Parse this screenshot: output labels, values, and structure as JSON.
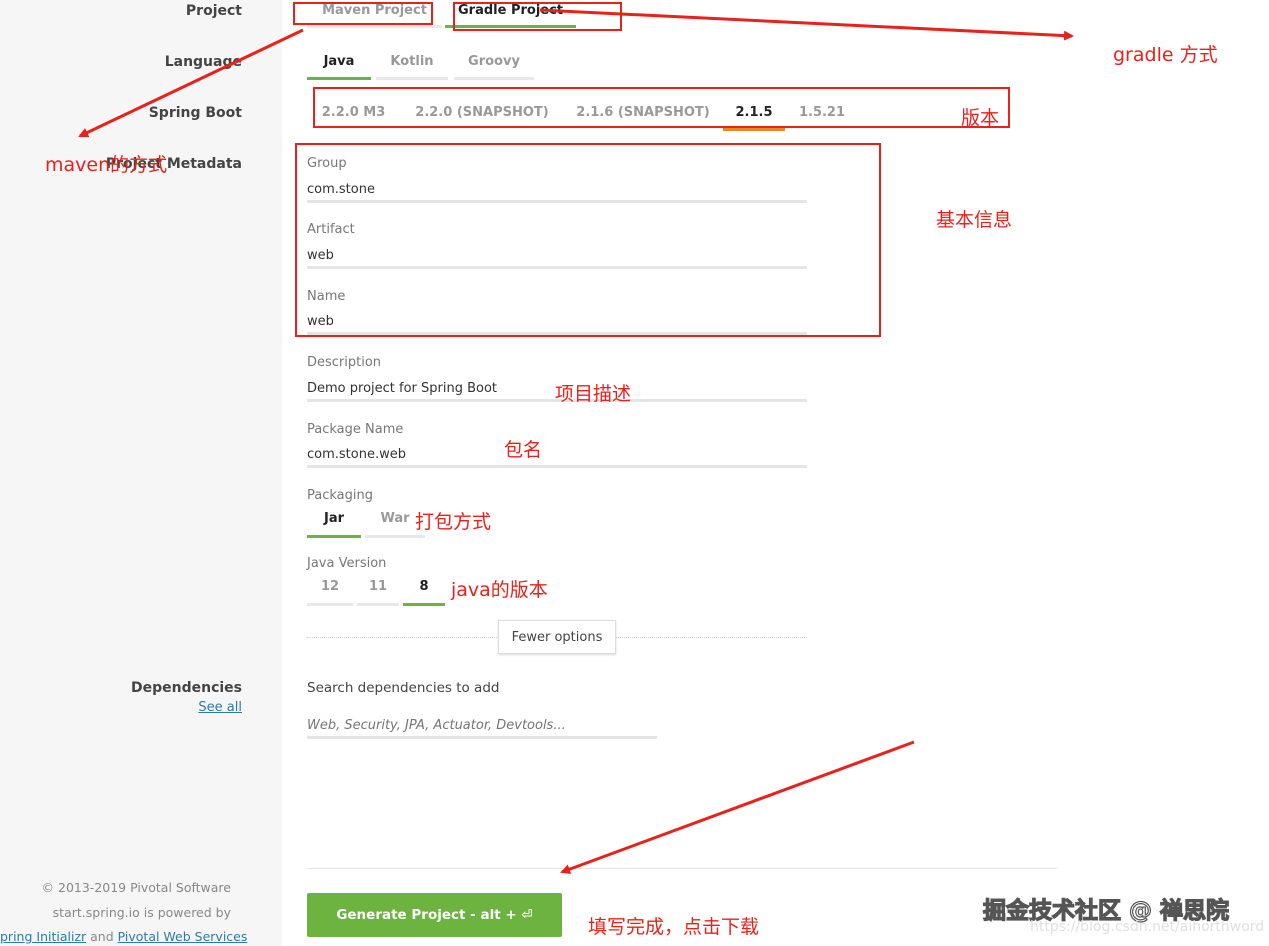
{
  "labels": {
    "project": "Project",
    "language": "Language",
    "spring_boot": "Spring Boot",
    "project_metadata": "Project Metadata",
    "dependencies": "Dependencies",
    "see_all": "See all"
  },
  "project_types": [
    "Maven Project",
    "Gradle Project"
  ],
  "languages": [
    "Java",
    "Kotlin",
    "Groovy"
  ],
  "boot_versions": [
    "2.2.0 M3",
    "2.2.0 (SNAPSHOT)",
    "2.1.6 (SNAPSHOT)",
    "2.1.5",
    "1.5.21"
  ],
  "metadata": {
    "group_label": "Group",
    "group_value": "com.stone",
    "artifact_label": "Artifact",
    "artifact_value": "web",
    "name_label": "Name",
    "name_value": "web",
    "description_label": "Description",
    "description_value": "Demo project for Spring Boot",
    "package_label": "Package Name",
    "package_value": "com.stone.web",
    "packaging_label": "Packaging",
    "java_version_label": "Java Version"
  },
  "packaging": [
    "Jar",
    "War"
  ],
  "java_versions": [
    "12",
    "11",
    "8"
  ],
  "fewer_options": "Fewer options",
  "dependencies": {
    "search_label": "Search dependencies to add",
    "placeholder": "Web, Security, JPA, Actuator, Devtools..."
  },
  "generate_button": "Generate Project - alt + ⏎",
  "footer": {
    "copyright": "© 2013-2019 Pivotal Software",
    "powered": "start.spring.io is powered by",
    "link1": "pring Initializr",
    "and": "and",
    "link2": "Pivotal Web Services"
  },
  "annotations": {
    "gradle": "gradle 方式",
    "version": "版本",
    "maven": "maven的方式",
    "basic_info": "基本信息",
    "description": "项目描述",
    "package": "包名",
    "packaging": "打包方式",
    "java": "java的版本",
    "generate": "填写完成，点击下载"
  },
  "watermark": {
    "main": "掘金技术社区 @ 禅思院",
    "url": "https://blog.csdn.net/aihorthword"
  },
  "colors": {
    "accent": "#6db33f",
    "annotation": "#e8221b"
  }
}
